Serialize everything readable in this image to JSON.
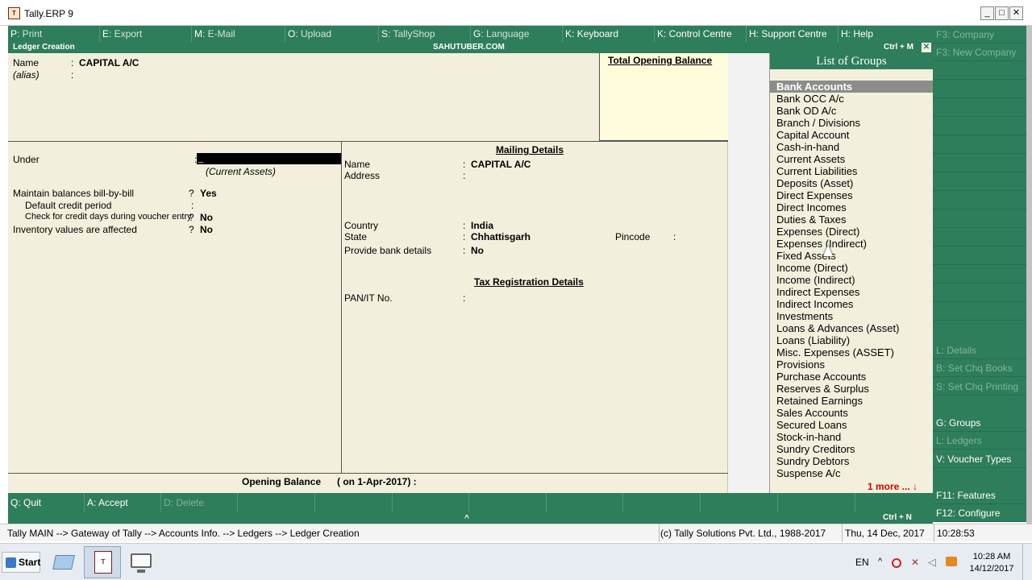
{
  "window": {
    "title": "Tally.ERP 9",
    "icon_text": "T"
  },
  "top_menu": [
    {
      "key": "P",
      "label": ": Print",
      "enabled": false
    },
    {
      "key": "E",
      "label": ": Export",
      "enabled": false
    },
    {
      "key": "M",
      "label": ": E-Mail",
      "enabled": false
    },
    {
      "key": "O",
      "label": ": Upload",
      "enabled": false
    },
    {
      "key": "S",
      "label": ": TallyShop",
      "enabled": false
    },
    {
      "key": "G",
      "label": ": Language",
      "enabled": false
    },
    {
      "key": "K",
      "label": ": Keyboard",
      "enabled": true
    },
    {
      "key": "K",
      "label": ": Control Centre",
      "enabled": true
    },
    {
      "key": "H",
      "label": ": Support Centre",
      "enabled": true
    },
    {
      "key": "H",
      "label": ": Help",
      "enabled": true
    }
  ],
  "header": {
    "title": "Ledger Creation",
    "center": "SAHUTUBER.COM",
    "shortcut": "Ctrl + M"
  },
  "ledger": {
    "name_label": "Name",
    "name_value": "CAPITAL A/C",
    "alias_label": "(alias)",
    "under_label": "Under",
    "under_value": "_",
    "under_subtext": "(Current Assets)",
    "total_opening_balance_label": "Total Opening Balance",
    "options": [
      {
        "label": "Maintain balances bill-by-bill",
        "sep": "?",
        "value": "Yes"
      },
      {
        "label": "Default credit period",
        "sep": ":",
        "value": ""
      },
      {
        "label": "Check for credit days during voucher entry",
        "sep": "?",
        "value": "No"
      },
      {
        "label": "Inventory values are affected",
        "sep": "?",
        "value": "No"
      }
    ],
    "mailing": {
      "title": "Mailing Details",
      "name_label": "Name",
      "name_value": "CAPITAL A/C",
      "address_label": "Address",
      "country_label": "Country",
      "country_value": "India",
      "state_label": "State",
      "state_value": "Chhattisgarh",
      "pincode_label": "Pincode",
      "bank_label": "Provide bank details",
      "bank_value": "No"
    },
    "tax": {
      "title": "Tax Registration Details",
      "pan_label": "PAN/IT No."
    },
    "opening_balance_label": "Opening Balance",
    "opening_balance_date": "( on 1-Apr-2017) :"
  },
  "groups": {
    "title": "List of Groups",
    "items": [
      "Bank Accounts",
      "Bank OCC A/c",
      "Bank OD A/c",
      "Branch / Divisions",
      "Capital Account",
      "Cash-in-hand",
      "Current Assets",
      "Current Liabilities",
      "Deposits (Asset)",
      "Direct Expenses",
      "Direct Incomes",
      "Duties & Taxes",
      "Expenses (Direct)",
      "Expenses (Indirect)",
      "Fixed Assets",
      "Income (Direct)",
      "Income (Indirect)",
      "Indirect Expenses",
      "Indirect Incomes",
      "Investments",
      "Loans & Advances (Asset)",
      "Loans (Liability)",
      "Misc. Expenses (ASSET)",
      "Provisions",
      "Purchase Accounts",
      "Reserves & Surplus",
      "Retained Earnings",
      "Sales Accounts",
      "Secured Loans",
      "Stock-in-hand",
      "Sundry Creditors",
      "Sundry Debtors",
      "Suspense A/c"
    ],
    "more": "1 more ... ↓"
  },
  "right_panel": {
    "top": [
      {
        "key": "F3",
        "label": ": Company",
        "enabled": false
      },
      {
        "key": "F3",
        "label": ": New Company",
        "enabled": false
      }
    ],
    "middle": [
      {
        "key": "L",
        "label": ": Details",
        "enabled": false
      },
      {
        "key": "B",
        "label": ": Set Chq Books",
        "enabled": false
      },
      {
        "key": "S",
        "label": ": Set Chq Printing",
        "enabled": false
      }
    ],
    "lower": [
      {
        "key": "G",
        "label": ": Groups",
        "enabled": true
      },
      {
        "key": "L",
        "label": ": Ledgers",
        "enabled": false
      },
      {
        "key": "V",
        "label": ": Voucher Types",
        "enabled": true
      }
    ],
    "bottom": [
      {
        "key": "F11",
        "label": ": Features",
        "enabled": true
      },
      {
        "key": "F12",
        "label": ": Configure",
        "enabled": true
      }
    ]
  },
  "bottom_buttons": [
    {
      "key": "Q",
      "label": ": Quit",
      "enabled": true
    },
    {
      "key": "A",
      "label": ": Accept",
      "enabled": true
    },
    {
      "key": "D",
      "label": ": Delete",
      "enabled": false
    }
  ],
  "bottom_bar": {
    "caret": "^",
    "shortcut": "Ctrl + N"
  },
  "status": {
    "breadcrumb": "Tally MAIN --> Gateway of Tally --> Accounts Info. --> Ledgers --> Ledger Creation",
    "copyright": "(c) Tally Solutions Pvt. Ltd., 1988-2017",
    "date": "Thu, 14 Dec, 2017",
    "time": "10:28:53"
  },
  "taskbar": {
    "start_label": "Start",
    "lang": "EN",
    "clock_time": "10:28 AM",
    "clock_date": "14/12/2017"
  },
  "colors": {
    "tally_green": "#2e7d5b",
    "form_bg": "#f2f0dc",
    "selected_group": "#8c8c8c",
    "more_red": "#d10000"
  }
}
